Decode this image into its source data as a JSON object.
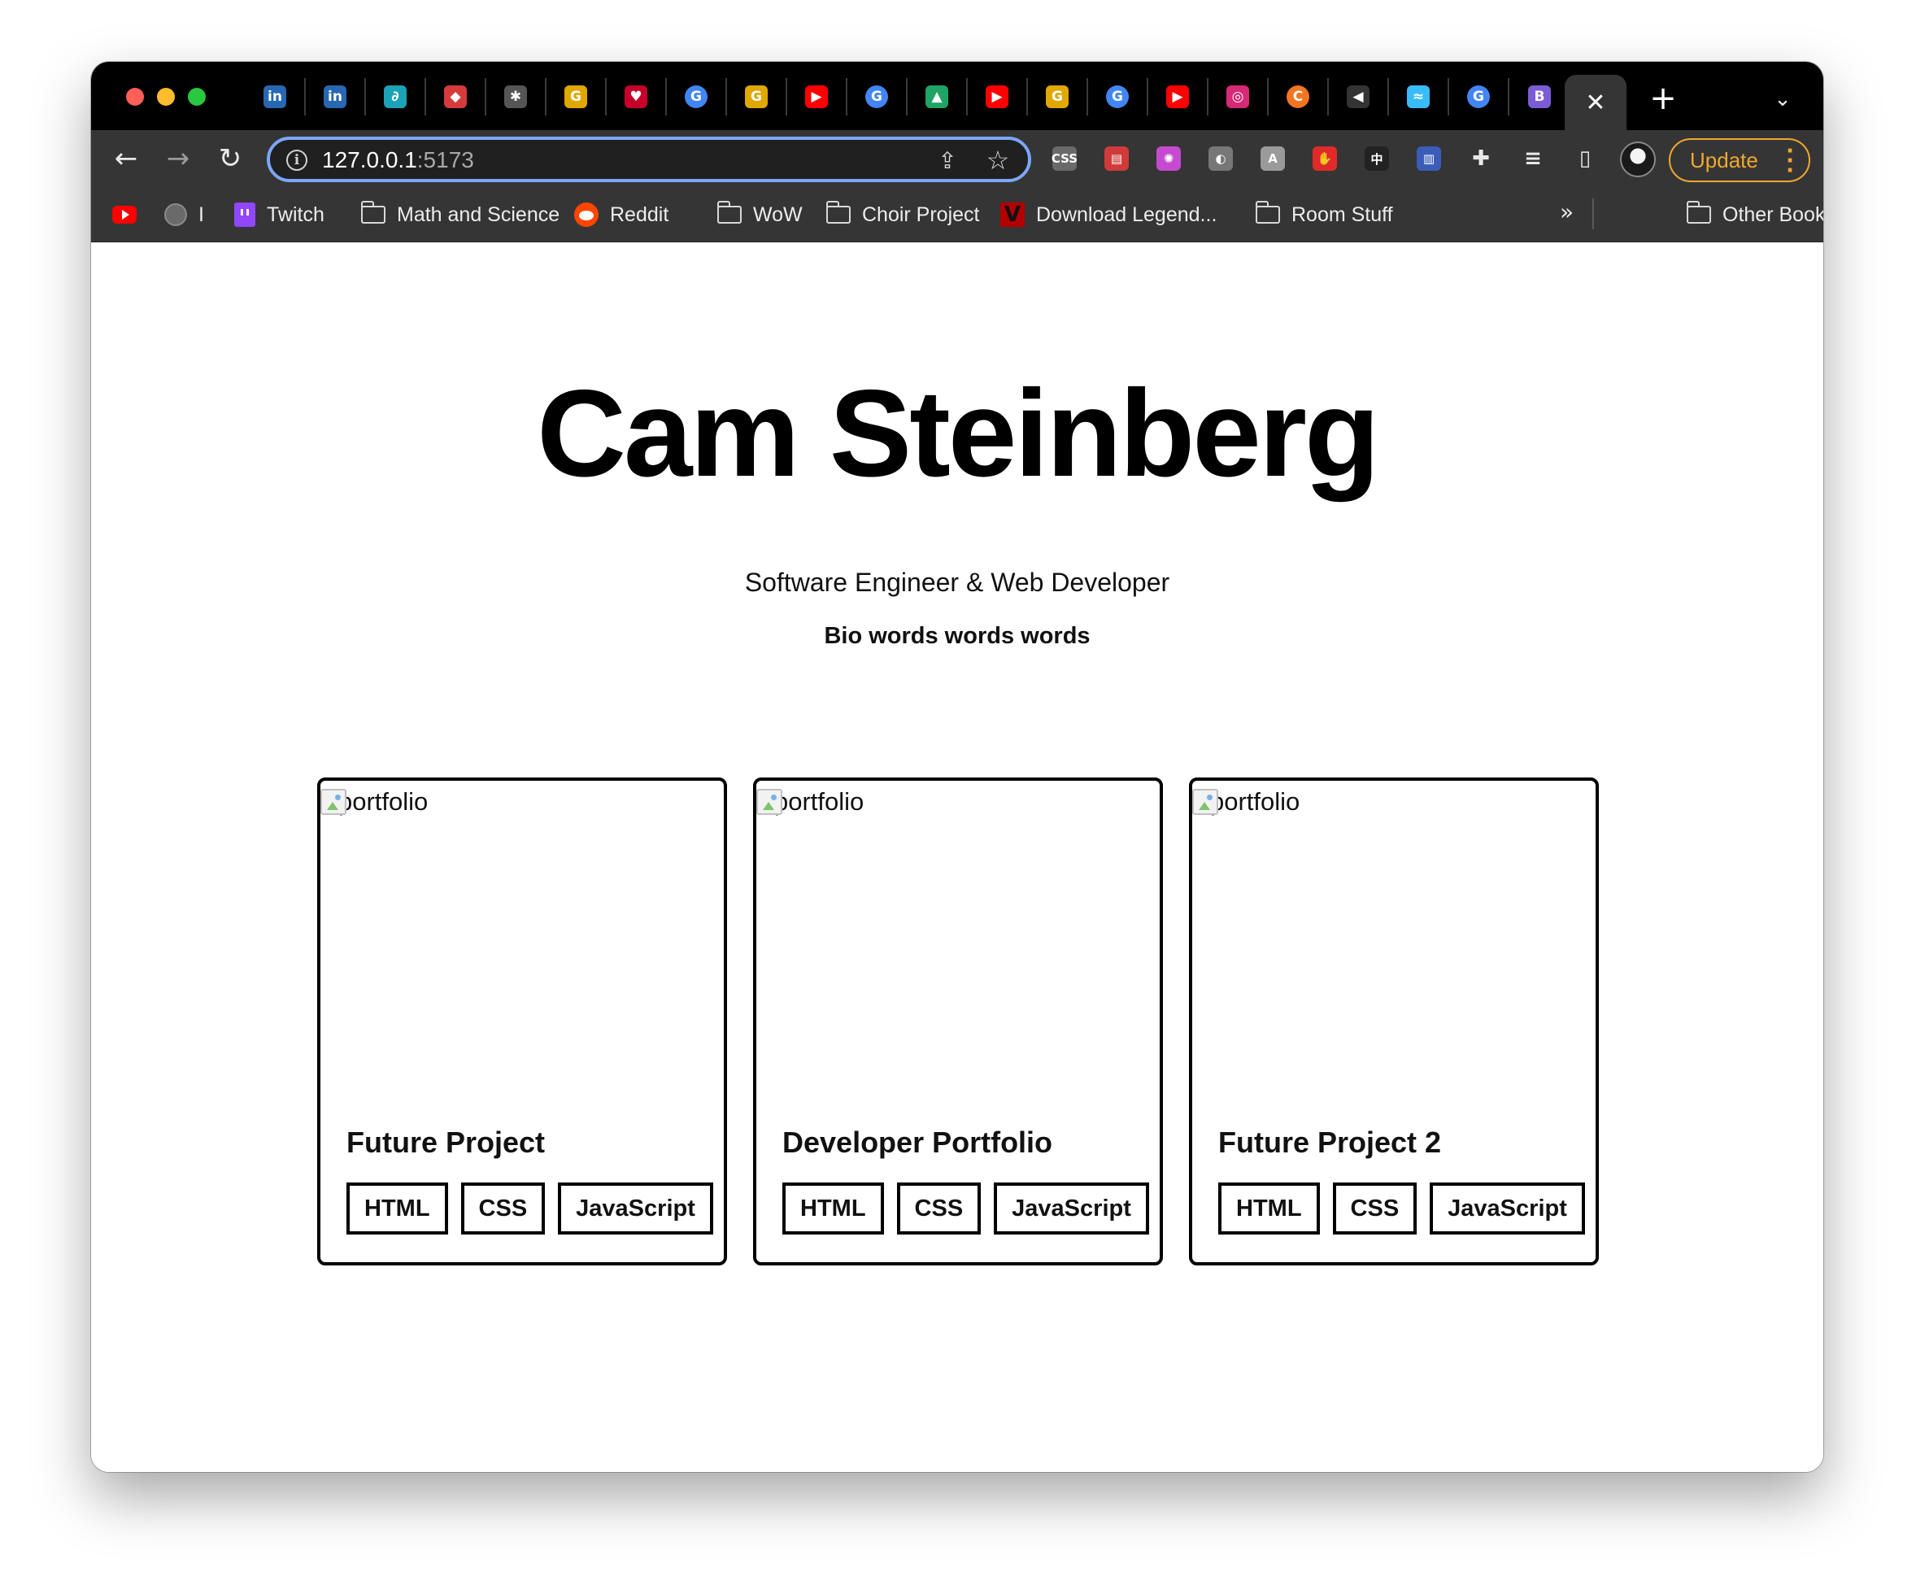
{
  "browser": {
    "tabs": [
      {
        "icon": "linkedin-icon",
        "glyph": "in",
        "color": "#2867b2"
      },
      {
        "icon": "linkedin-icon",
        "glyph": "in",
        "color": "#2867b2"
      },
      {
        "icon": "link-icon",
        "glyph": "∂",
        "color": "#1aa3b8"
      },
      {
        "icon": "red-app-icon",
        "glyph": "◆",
        "color": "#d63b3b"
      },
      {
        "icon": "robot-icon",
        "glyph": "✱",
        "color": "#555555"
      },
      {
        "icon": "grammarly-icon",
        "glyph": "G",
        "color": "#e0a800"
      },
      {
        "icon": "iheart-icon",
        "glyph": "♥",
        "color": "#c6002b"
      },
      {
        "icon": "google-icon",
        "glyph": "G",
        "color": "#4285f4"
      },
      {
        "icon": "grammarly-icon",
        "glyph": "G",
        "color": "#e0a800"
      },
      {
        "icon": "youtube-icon",
        "glyph": "▶",
        "color": "#ff0000"
      },
      {
        "icon": "google-icon",
        "glyph": "G",
        "color": "#4285f4"
      },
      {
        "icon": "google-drive-icon",
        "glyph": "▲",
        "color": "#1fa463"
      },
      {
        "icon": "youtube-icon",
        "glyph": "▶",
        "color": "#ff0000"
      },
      {
        "icon": "grammarly-icon",
        "glyph": "G",
        "color": "#e0a800"
      },
      {
        "icon": "google-icon",
        "glyph": "G",
        "color": "#4285f4"
      },
      {
        "icon": "youtube-icon",
        "glyph": "▶",
        "color": "#ff0000"
      },
      {
        "icon": "instagram-icon",
        "glyph": "◎",
        "color": "#d62976"
      },
      {
        "icon": "crunchyroll-icon",
        "glyph": "C",
        "color": "#f47521"
      },
      {
        "icon": "speaker-icon",
        "glyph": "◀",
        "color": "#333333"
      },
      {
        "icon": "tailwind-icon",
        "glyph": "≈",
        "color": "#38bdf8"
      },
      {
        "icon": "google-icon",
        "glyph": "G",
        "color": "#4285f4"
      },
      {
        "icon": "colorful-app-icon",
        "glyph": "B",
        "color": "#7b5cd6"
      }
    ],
    "active_tab_close": "✕",
    "new_tab": "+",
    "tab_search": "⌄",
    "url_host": "127.0.0.1",
    "url_port": ":5173",
    "update_label": "Update",
    "extensions": [
      {
        "icon": "css-extension-icon",
        "glyph": "CSS",
        "color": "#6a6a6a"
      },
      {
        "icon": "calendar-extension-icon",
        "glyph": "▤",
        "color": "#d03a3a"
      },
      {
        "icon": "color-wheel-extension-icon",
        "glyph": "✺",
        "color": "#c64ad0"
      },
      {
        "icon": "spy-extension-icon",
        "glyph": "◐",
        "color": "#777777"
      },
      {
        "icon": "font-extension-icon",
        "glyph": "A",
        "color": "#9a9a9a"
      },
      {
        "icon": "adblock-extension-icon",
        "glyph": "✋",
        "color": "#e02a2a"
      },
      {
        "icon": "translate-extension-icon",
        "glyph": "中",
        "color": "#222222"
      },
      {
        "icon": "book-extension-icon",
        "glyph": "▥",
        "color": "#3b5cb8"
      },
      {
        "icon": "puzzle-extensions-icon",
        "glyph": "✚",
        "color": "#353535"
      },
      {
        "icon": "media-queue-icon",
        "glyph": "≡",
        "color": "#353535"
      },
      {
        "icon": "side-panel-icon",
        "glyph": "▯",
        "color": "#353535"
      }
    ]
  },
  "bookmarks": [
    {
      "icon": "youtube-bookmark-icon",
      "label": ""
    },
    {
      "icon": "globe-icon",
      "label": "I"
    },
    {
      "icon": "twitch-icon",
      "label": "Twitch"
    },
    {
      "icon": "folder-icon",
      "label": "Math and Science"
    },
    {
      "icon": "reddit-icon",
      "label": "Reddit"
    },
    {
      "icon": "folder-icon",
      "label": "WoW"
    },
    {
      "icon": "folder-icon",
      "label": "Choir Project"
    },
    {
      "icon": "v-icon",
      "label": "Download Legend..."
    },
    {
      "icon": "folder-icon",
      "label": "Room Stuff"
    }
  ],
  "bookmarks_overflow": "»",
  "other_bookmarks": "Other Bookmarks",
  "hero": {
    "name": "Cam Steinberg",
    "role": "Software Engineer & Web Developer",
    "bio": "Bio words words words"
  },
  "projects": [
    {
      "image_alt": "portfolio",
      "title": "Future Project",
      "tags": [
        "HTML",
        "CSS",
        "JavaScript"
      ]
    },
    {
      "image_alt": "portfolio",
      "title": "Developer Portfolio",
      "tags": [
        "HTML",
        "CSS",
        "JavaScript"
      ]
    },
    {
      "image_alt": "portfolio",
      "title": "Future Project 2",
      "tags": [
        "HTML",
        "CSS",
        "JavaScript"
      ]
    }
  ]
}
